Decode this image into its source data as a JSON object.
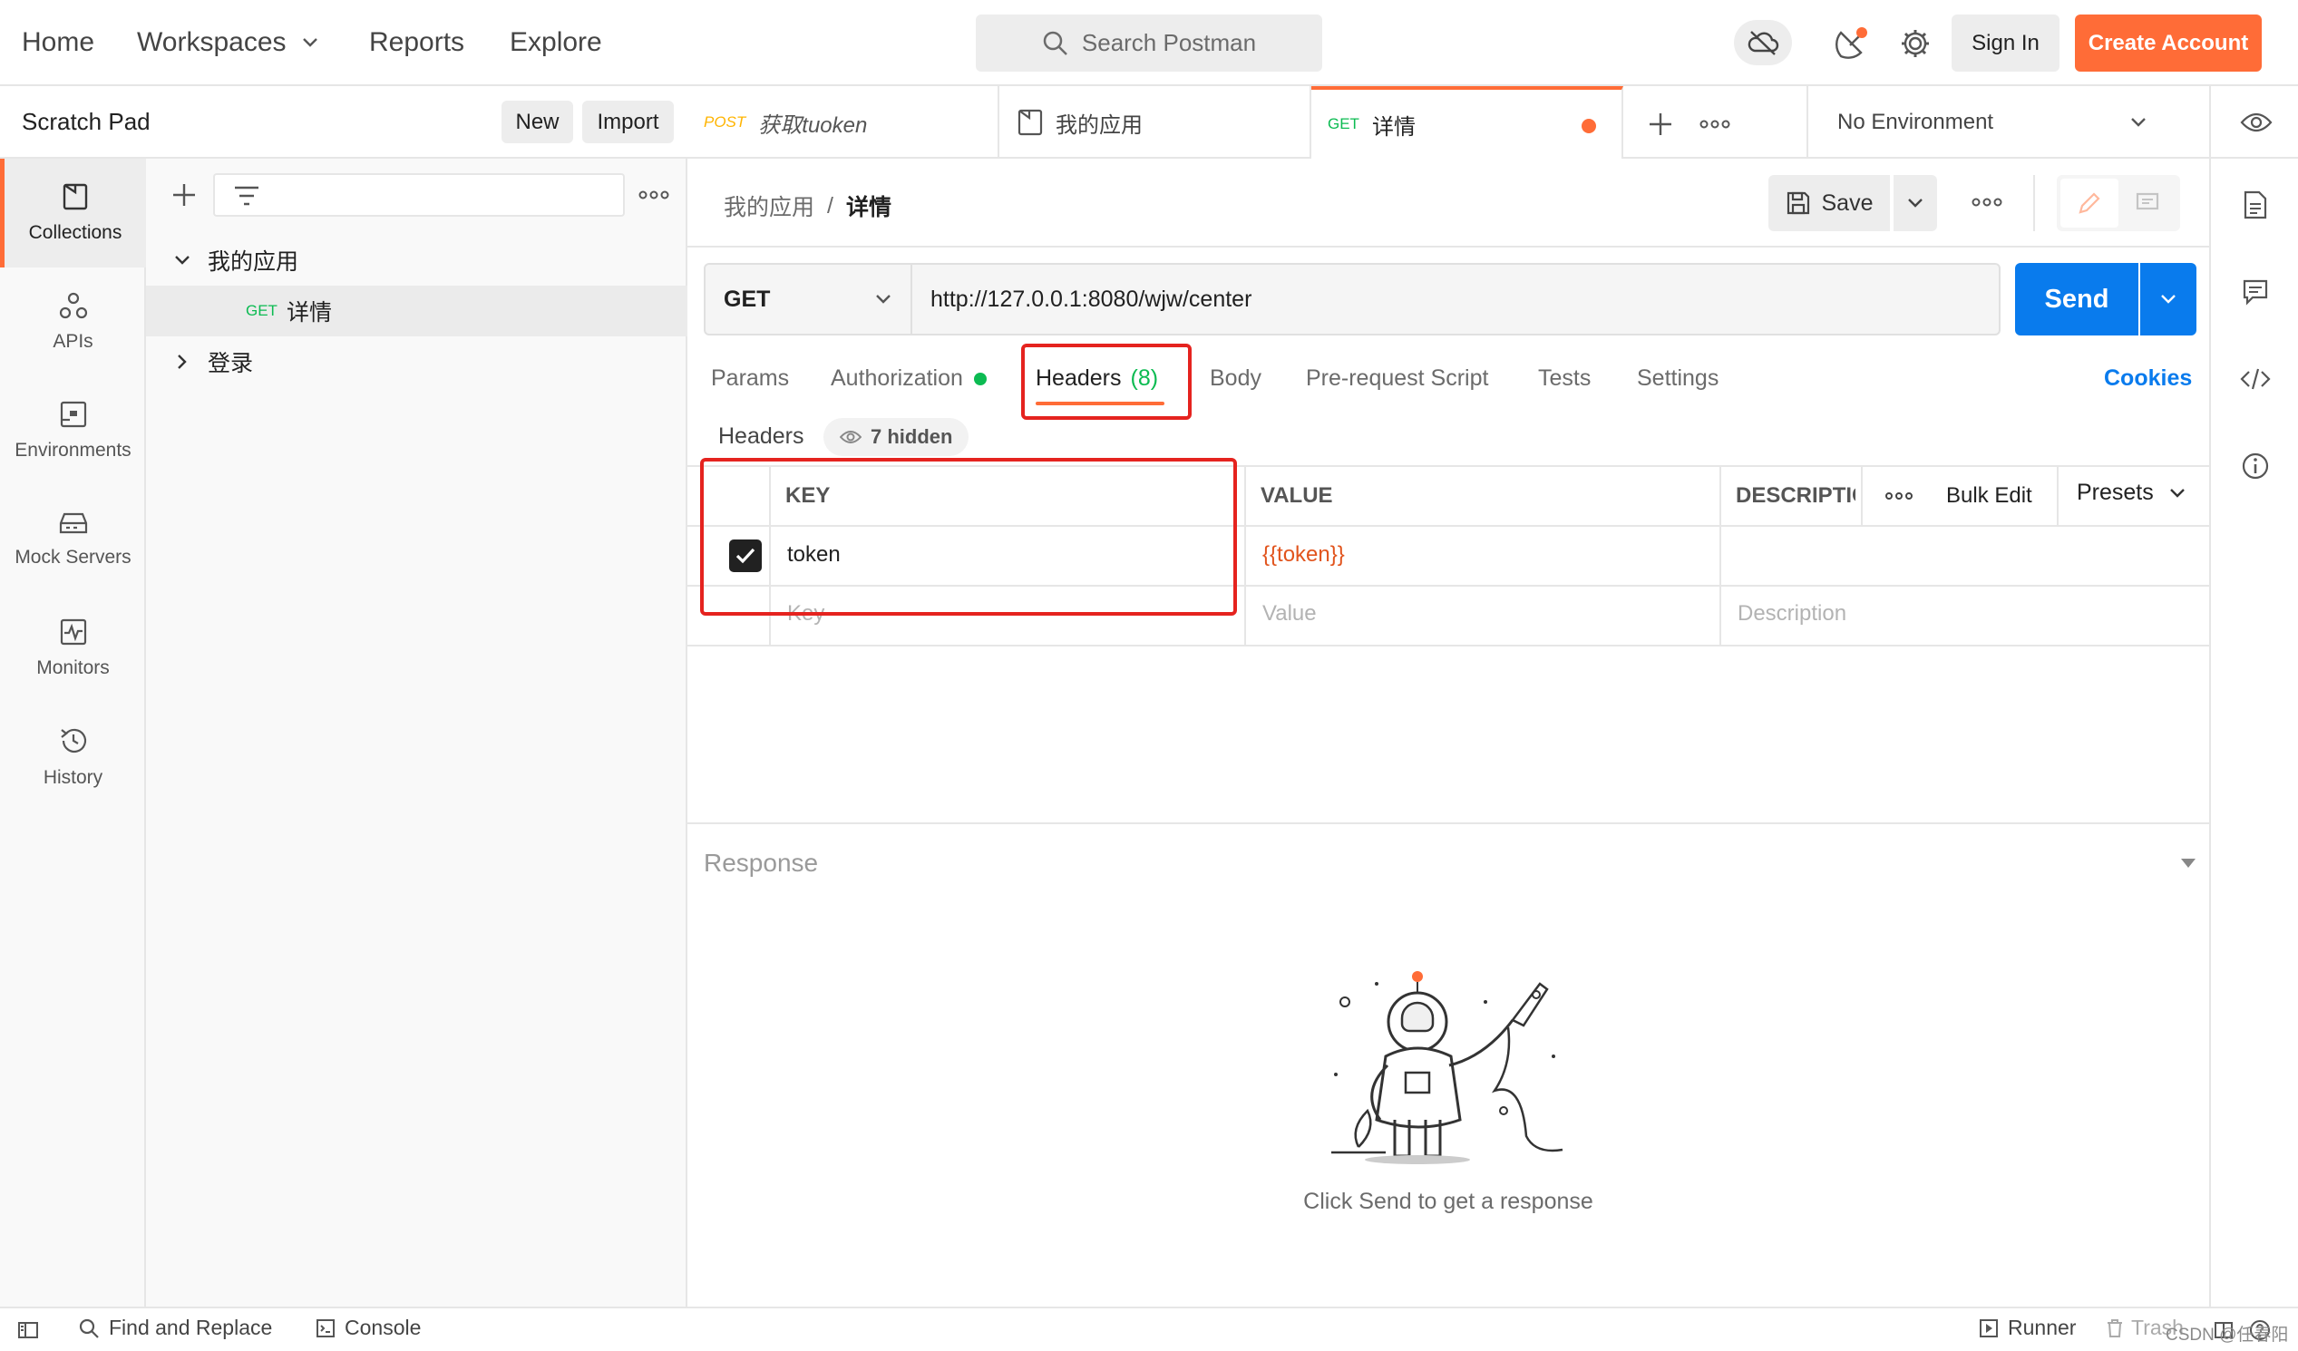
{
  "topbar": {
    "nav": [
      "Home",
      "Workspaces",
      "Reports",
      "Explore"
    ],
    "search_placeholder": "Search Postman",
    "sign_in": "Sign In",
    "create_account": "Create Account"
  },
  "scratch": {
    "title": "Scratch Pad",
    "new_label": "New",
    "import_label": "Import"
  },
  "sidebar": {
    "items": [
      {
        "label": "Collections",
        "icon": "collections-icon"
      },
      {
        "label": "APIs",
        "icon": "apis-icon"
      },
      {
        "label": "Environments",
        "icon": "environments-icon"
      },
      {
        "label": "Mock Servers",
        "icon": "mock-servers-icon"
      },
      {
        "label": "Monitors",
        "icon": "monitors-icon"
      },
      {
        "label": "History",
        "icon": "history-icon"
      }
    ]
  },
  "collections": {
    "tree": [
      {
        "name": "我的应用",
        "expanded": true
      },
      {
        "method": "GET",
        "name": "详情"
      },
      {
        "name": "登录",
        "expanded": false
      }
    ]
  },
  "tabs": [
    {
      "method": "POST",
      "name": "获取tuoken"
    },
    {
      "name": "我的应用"
    },
    {
      "method": "GET",
      "name": "详情"
    }
  ],
  "environment": "No Environment",
  "breadcrumb": {
    "parent": "我的应用",
    "separator": "/",
    "current": "详情"
  },
  "save_label": "Save",
  "request": {
    "method": "GET",
    "url": "http://127.0.0.1:8080/wjw/center",
    "send_label": "Send"
  },
  "subtabs": {
    "params": "Params",
    "authorization": "Authorization",
    "headers": "Headers",
    "headers_count": "(8)",
    "body": "Body",
    "prerequest": "Pre-request Script",
    "tests": "Tests",
    "settings": "Settings",
    "cookies": "Cookies"
  },
  "headers_section": {
    "title": "Headers",
    "hidden": "7 hidden"
  },
  "table": {
    "key_header": "KEY",
    "value_header": "VALUE",
    "desc_header": "DESCRIPTIC",
    "bulk_edit": "Bulk Edit",
    "presets": "Presets",
    "rows": [
      {
        "key": "token",
        "value": "{{token}}",
        "checked": true
      }
    ],
    "key_placeholder": "Key",
    "value_placeholder": "Value",
    "desc_placeholder": "Description"
  },
  "response": {
    "title": "Response",
    "empty_message": "Click Send to get a response"
  },
  "statusbar": {
    "find_replace": "Find and Replace",
    "console": "Console",
    "runner": "Runner",
    "trash": "Trash",
    "watermark": "CSDN @任春阳"
  },
  "colors": {
    "accent": "#ff6c37",
    "send": "#097bed",
    "get": "#0cbb52",
    "post": "#ffb400",
    "highlight_box": "#e5231f"
  }
}
